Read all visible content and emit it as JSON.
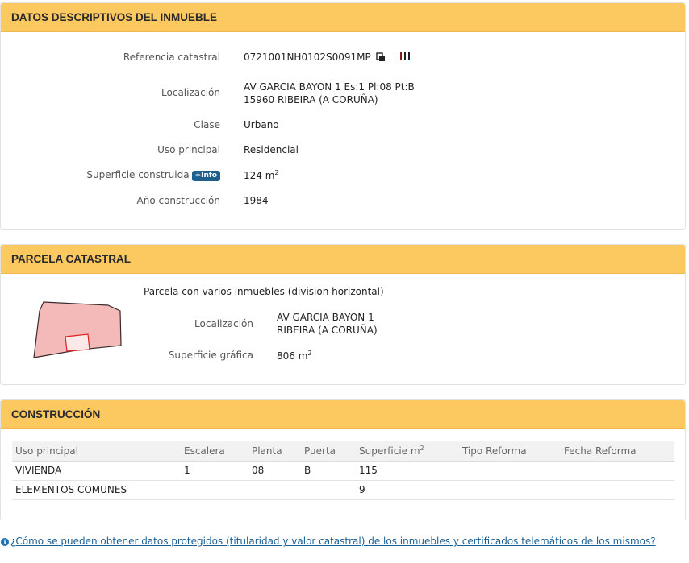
{
  "descriptivos": {
    "title": "DATOS DESCRIPTIVOS DEL INMUEBLE",
    "ref_label": "Referencia catastral",
    "ref_value": "0721001NH0102S0091MP",
    "loc_label": "Localización",
    "loc_line1": "AV GARCIA BAYON 1 Es:1 Pl:08 Pt:B",
    "loc_line2": "15960 RIBEIRA (A CORUÑA)",
    "clase_label": "Clase",
    "clase_value": "Urbano",
    "uso_label": "Uso principal",
    "uso_value": "Residencial",
    "sup_label": "Superficie construida",
    "sup_info": "+Info",
    "sup_value": "124 m",
    "sup_unit_exp": "2",
    "anio_label": "Año construcción",
    "anio_value": "1984",
    "copy_icon": "copy-icon",
    "barcode_icon": "barcode-icon"
  },
  "parcela": {
    "title": "PARCELA CATASTRAL",
    "desc": "Parcela con varios inmuebles (division horizontal)",
    "loc_label": "Localización",
    "loc_line1": "AV GARCIA BAYON 1",
    "loc_line2": "RIBEIRA (A CORUÑA)",
    "sup_label": "Superficie gráfica",
    "sup_value": "806 m",
    "sup_unit_exp": "2",
    "fill_color": "#f4b9b9",
    "highlight_color": "#e02020"
  },
  "construccion": {
    "title": "CONSTRUCCIÓN",
    "headers": {
      "uso": "Uso principal",
      "escalera": "Escalera",
      "planta": "Planta",
      "puerta": "Puerta",
      "superficie": "Superficie m",
      "superficie_exp": "2",
      "tipo": "Tipo Reforma",
      "fecha": "Fecha Reforma"
    },
    "rows": [
      {
        "uso": "VIVIENDA",
        "escalera": "1",
        "planta": "08",
        "puerta": "B",
        "superficie": "115",
        "tipo": "",
        "fecha": ""
      },
      {
        "uso": "ELEMENTOS COMUNES",
        "escalera": "",
        "planta": "",
        "puerta": "",
        "superficie": "9",
        "tipo": "",
        "fecha": ""
      }
    ]
  },
  "footer": {
    "info_icon": "info-icon",
    "link_text": "¿Cómo se pueden obtener datos protegidos (titularidad y valor catastral) de los inmuebles y certificados telemáticos de los mismos?"
  }
}
